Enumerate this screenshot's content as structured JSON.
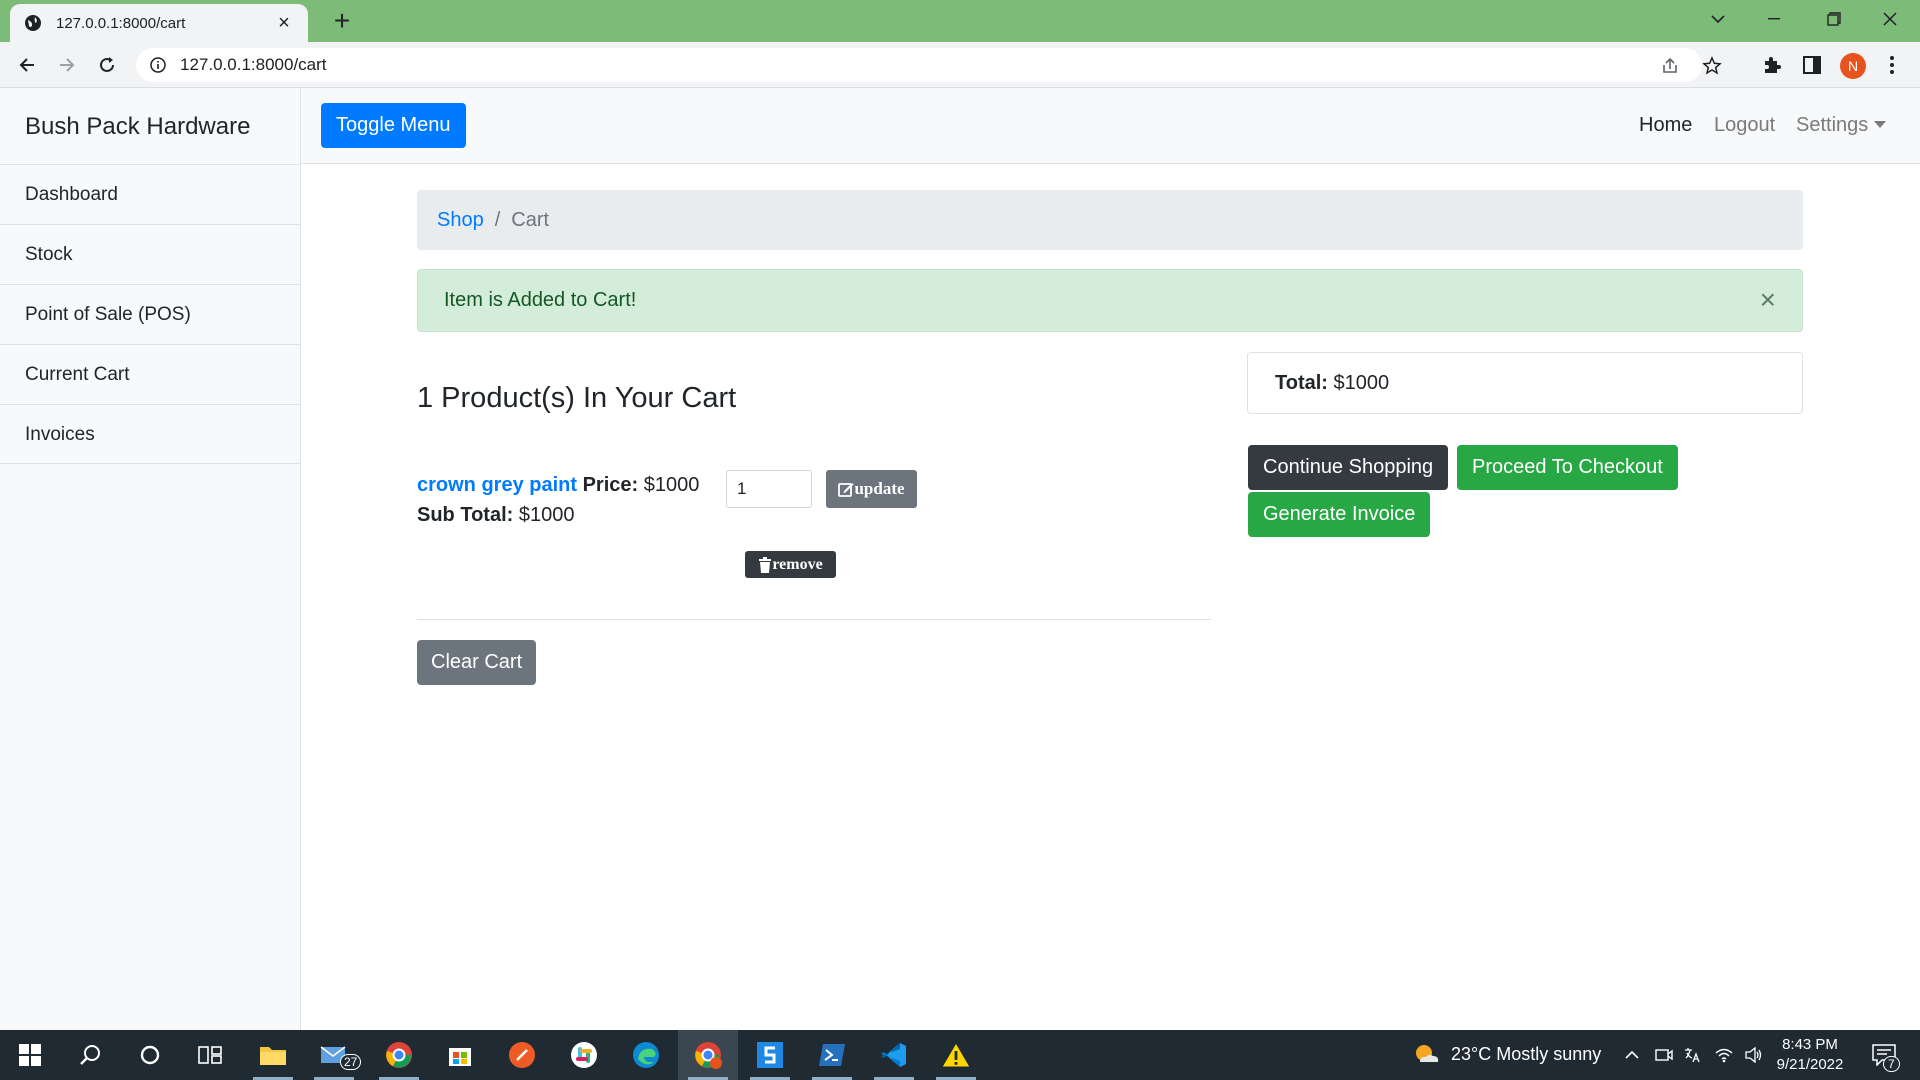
{
  "browser": {
    "tab_title": "127.0.0.1:8000/cart",
    "url": "127.0.0.1:8000/cart",
    "profile_initial": "N"
  },
  "sidebar": {
    "brand": "Bush Pack Hardware",
    "items": [
      {
        "label": "Dashboard"
      },
      {
        "label": "Stock"
      },
      {
        "label": "Point of Sale (POS)"
      },
      {
        "label": "Current Cart"
      },
      {
        "label": "Invoices"
      }
    ]
  },
  "topnav": {
    "toggle_label": "Toggle Menu",
    "home": "Home",
    "logout": "Logout",
    "settings": "Settings"
  },
  "breadcrumb": {
    "shop": "Shop",
    "separator": "/",
    "current": "Cart"
  },
  "alert": {
    "message": "Item is Added to Cart!",
    "close": "×"
  },
  "cart": {
    "title": "1 Product(s) In Your Cart",
    "item": {
      "name": "crown grey paint",
      "price_label": "Price:",
      "price": "$1000",
      "subtotal_label": "Sub Total:",
      "subtotal": "$1000",
      "quantity": "1",
      "update_label": "update",
      "remove_label": "remove"
    },
    "clear_label": "Clear Cart"
  },
  "summary": {
    "total_label": "Total:",
    "total_value": "$1000",
    "continue_label": "Continue Shopping",
    "checkout_label": "Proceed To Checkout",
    "invoice_label": "Generate Invoice"
  },
  "taskbar": {
    "mail_badge": "27",
    "weather": "23°C  Mostly sunny",
    "time": "8:43 PM",
    "date": "9/21/2022",
    "notification_count": "7"
  },
  "colors": {
    "primary": "#007bff",
    "success": "#28a745",
    "secondary": "#6c757d",
    "dark": "#343a40",
    "alert_bg": "#d4edda",
    "chrome_green": "#7dbb79"
  }
}
